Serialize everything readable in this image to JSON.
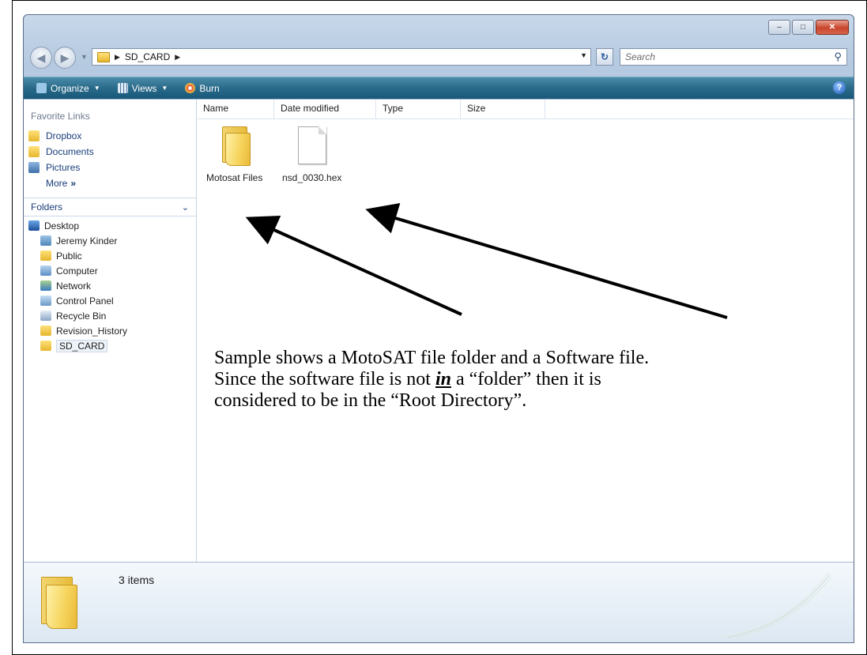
{
  "window": {
    "caption_buttons": [
      "–",
      "□",
      "✕"
    ]
  },
  "address_bar": {
    "path": [
      "SD_CARD"
    ],
    "search_placeholder": "Search"
  },
  "toolbar": {
    "organize": "Organize",
    "views": "Views",
    "burn": "Burn"
  },
  "nav_pane": {
    "favorite_links_header": "Favorite Links",
    "favorite_links": [
      {
        "label": "Dropbox",
        "icon": "dropbox-icon"
      },
      {
        "label": "Documents",
        "icon": "documents-icon"
      },
      {
        "label": "Pictures",
        "icon": "pictures-icon"
      }
    ],
    "more_label": "More",
    "folders_header": "Folders",
    "tree": [
      {
        "label": "Desktop",
        "icon": "desktop-icon",
        "indent": 0
      },
      {
        "label": "Jeremy Kinder",
        "icon": "user-folder-icon",
        "indent": 1
      },
      {
        "label": "Public",
        "icon": "folder-icon",
        "indent": 1
      },
      {
        "label": "Computer",
        "icon": "computer-icon",
        "indent": 1
      },
      {
        "label": "Network",
        "icon": "network-icon",
        "indent": 1
      },
      {
        "label": "Control Panel",
        "icon": "control-panel-icon",
        "indent": 1
      },
      {
        "label": "Recycle Bin",
        "icon": "recycle-bin-icon",
        "indent": 1
      },
      {
        "label": "Revision_History",
        "icon": "folder-icon",
        "indent": 1
      },
      {
        "label": "SD_CARD",
        "icon": "folder-icon",
        "indent": 1,
        "selected": true
      }
    ]
  },
  "columns": [
    "Name",
    "Date modified",
    "Type",
    "Size"
  ],
  "items": [
    {
      "label": "Motosat Files",
      "kind": "folder"
    },
    {
      "label": "nsd_0030.hex",
      "kind": "file"
    }
  ],
  "annotation": {
    "line1": "Sample shows a MotoSAT file folder and a Software file.",
    "line2_a": "Since the software file is not ",
    "line2_em": "in",
    "line2_b": " a “folder” then it is",
    "line3": "considered to be in the “Root Directory”."
  },
  "details": {
    "count": "3 items"
  },
  "colors": {
    "toolbar": "#2a6a89",
    "link": "#1a3d7a",
    "folder": "#f5d35a"
  }
}
